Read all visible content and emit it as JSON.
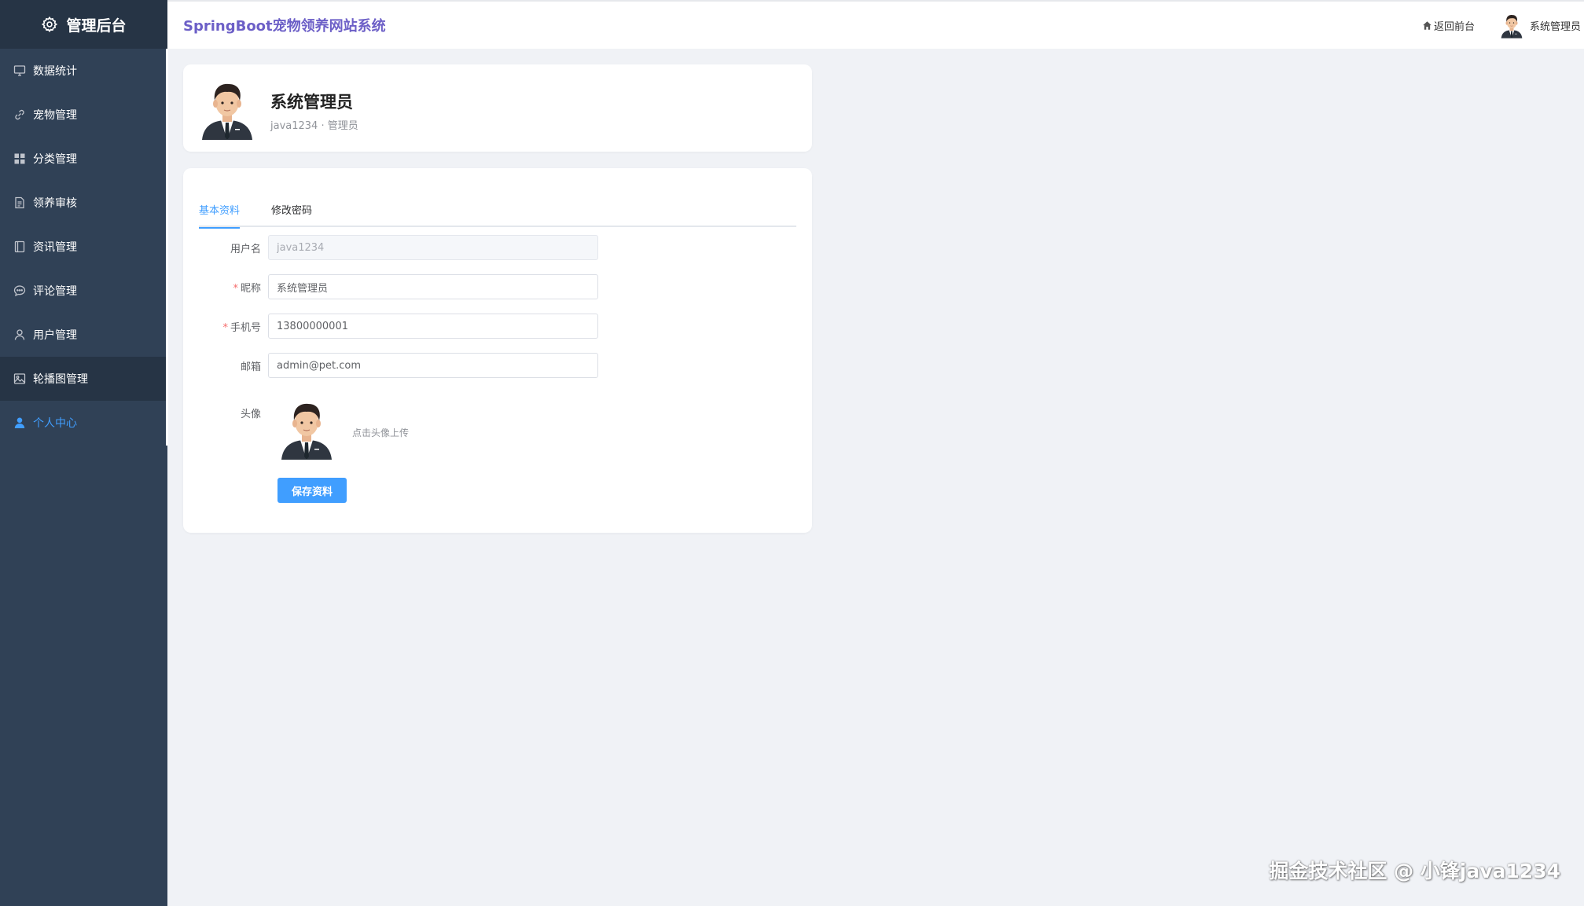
{
  "sidebar": {
    "brand": "管理后台",
    "items": [
      {
        "label": "数据统计",
        "icon": "monitor-icon"
      },
      {
        "label": "宠物管理",
        "icon": "link-icon"
      },
      {
        "label": "分类管理",
        "icon": "grid-icon"
      },
      {
        "label": "领养审核",
        "icon": "document-icon"
      },
      {
        "label": "资讯管理",
        "icon": "notebook-icon"
      },
      {
        "label": "评论管理",
        "icon": "chat-icon"
      },
      {
        "label": "用户管理",
        "icon": "user-icon"
      },
      {
        "label": "轮播图管理",
        "icon": "picture-icon"
      },
      {
        "label": "个人中心",
        "icon": "user-filled-icon"
      }
    ]
  },
  "header": {
    "title": "SpringBoot宠物领养网站系统",
    "back_label": "返回前台",
    "user_name": "系统管理员"
  },
  "profile": {
    "name": "系统管理员",
    "subtitle": "java1234 · 管理员"
  },
  "tabs": [
    {
      "label": "基本资料",
      "active": true
    },
    {
      "label": "修改密码",
      "active": false
    }
  ],
  "form": {
    "username": {
      "label": "用户名",
      "value": "java1234"
    },
    "nickname": {
      "label": "昵称",
      "value": "系统管理员"
    },
    "phone": {
      "label": "手机号",
      "value": "13800000001"
    },
    "email": {
      "label": "邮箱",
      "value": "admin@pet.com"
    },
    "avatar": {
      "label": "头像",
      "hint": "点击头像上传"
    },
    "save_label": "保存资料"
  },
  "watermark": "掘金技术社区 @ 小锋java1234",
  "colors": {
    "sidebar_bg": "#304156",
    "sidebar_dark": "#263445",
    "accent": "#409eff",
    "title_purple": "#6c5fc7",
    "required": "#f56c6c"
  }
}
